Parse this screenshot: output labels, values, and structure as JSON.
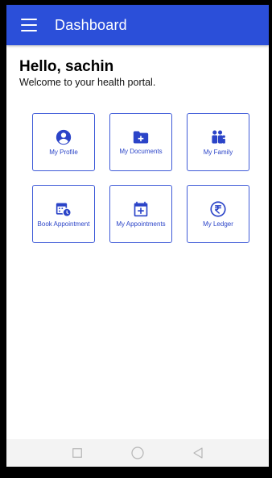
{
  "appbar": {
    "title": "Dashboard",
    "background_color": "#2b4fd9",
    "menu_icon": "menu-icon"
  },
  "greeting": {
    "hello": "Hello, sachin",
    "subtitle": "Welcome to your health portal."
  },
  "tiles": [
    {
      "label": "My Profile",
      "icon": "account-circle-icon"
    },
    {
      "label": "My Documents",
      "icon": "folder-plus-icon"
    },
    {
      "label": "My Family",
      "icon": "family-icon"
    },
    {
      "label": "Book Appointment",
      "icon": "calendar-clock-icon"
    },
    {
      "label": "My Appointments",
      "icon": "calendar-plus-icon"
    },
    {
      "label": "My Ledger",
      "icon": "rupee-icon"
    }
  ],
  "colors": {
    "accent": "#2b4fd9",
    "tile_border": "#3f5bd8",
    "tile_text": "#2b44c8"
  },
  "navbar": {
    "buttons": [
      "recent-apps-icon",
      "home-icon",
      "back-icon"
    ]
  }
}
